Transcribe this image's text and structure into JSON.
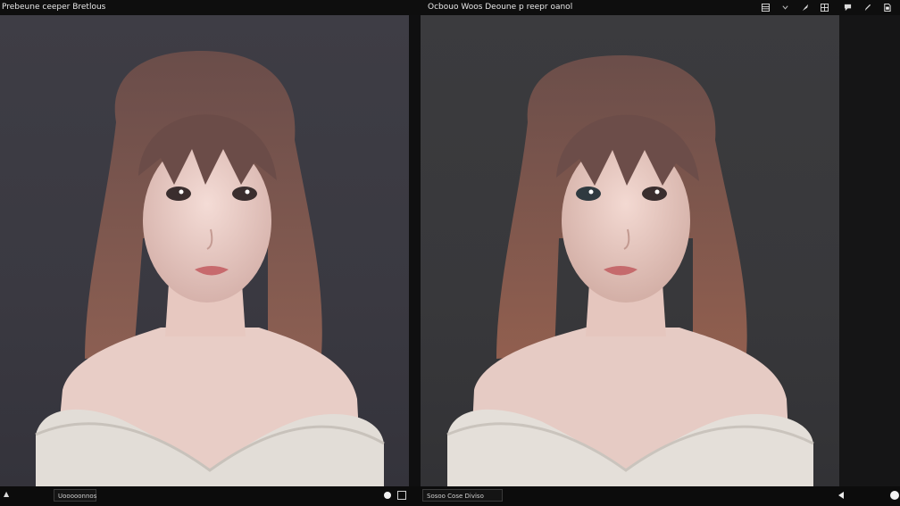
{
  "left_pane": {
    "title": "Prebeune ceeper Bretlous"
  },
  "right_pane": {
    "title": "Ocbouo Woos Deoune p reepr oanol"
  },
  "toolbar": {
    "icons": [
      "layout-icon",
      "chevron-down-icon",
      "brush-icon",
      "grid-icon",
      "chat-icon",
      "pen-icon",
      "export-icon"
    ]
  },
  "bottom_bar": {
    "left_field": "Uooooonnos",
    "right_field": "Sosoo Cose Diviso"
  },
  "colors": {
    "background": "#111111",
    "left_canvas": "#3c3b43",
    "right_canvas": "#3a3a3d",
    "hair": "#6e4f49",
    "sweater": "#e2ddd7"
  }
}
